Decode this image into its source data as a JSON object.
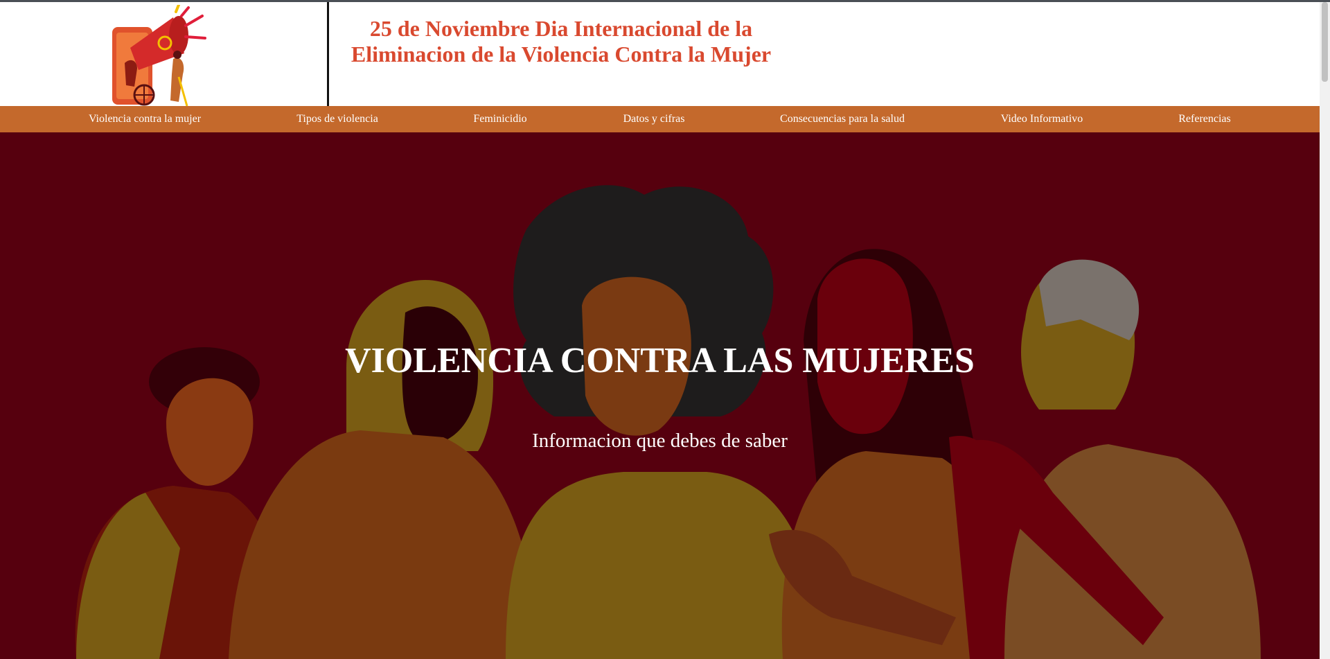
{
  "header": {
    "title_line1": "25 de Noviembre Dia Internacional de la",
    "title_line2": "Eliminacion de la Violencia Contra la Mujer",
    "logo_icon": "megaphone-protest-logo"
  },
  "nav": {
    "items": [
      {
        "label": "Violencia contra la mujer"
      },
      {
        "label": "Tipos de violencia"
      },
      {
        "label": "Feminicidio"
      },
      {
        "label": "Datos y cifras"
      },
      {
        "label": "Consecuencias para la salud"
      },
      {
        "label": "Video Informativo"
      },
      {
        "label": "Referencias"
      }
    ]
  },
  "hero": {
    "title": "VIOLENCIA CONTRA LAS MUJERES",
    "subtitle": "Informacion que debes de saber",
    "illustration": "group-of-women-illustration"
  },
  "colors": {
    "title_color": "#d9492f",
    "nav_bg": "#c4692c",
    "hero_bg": "#56000e"
  }
}
